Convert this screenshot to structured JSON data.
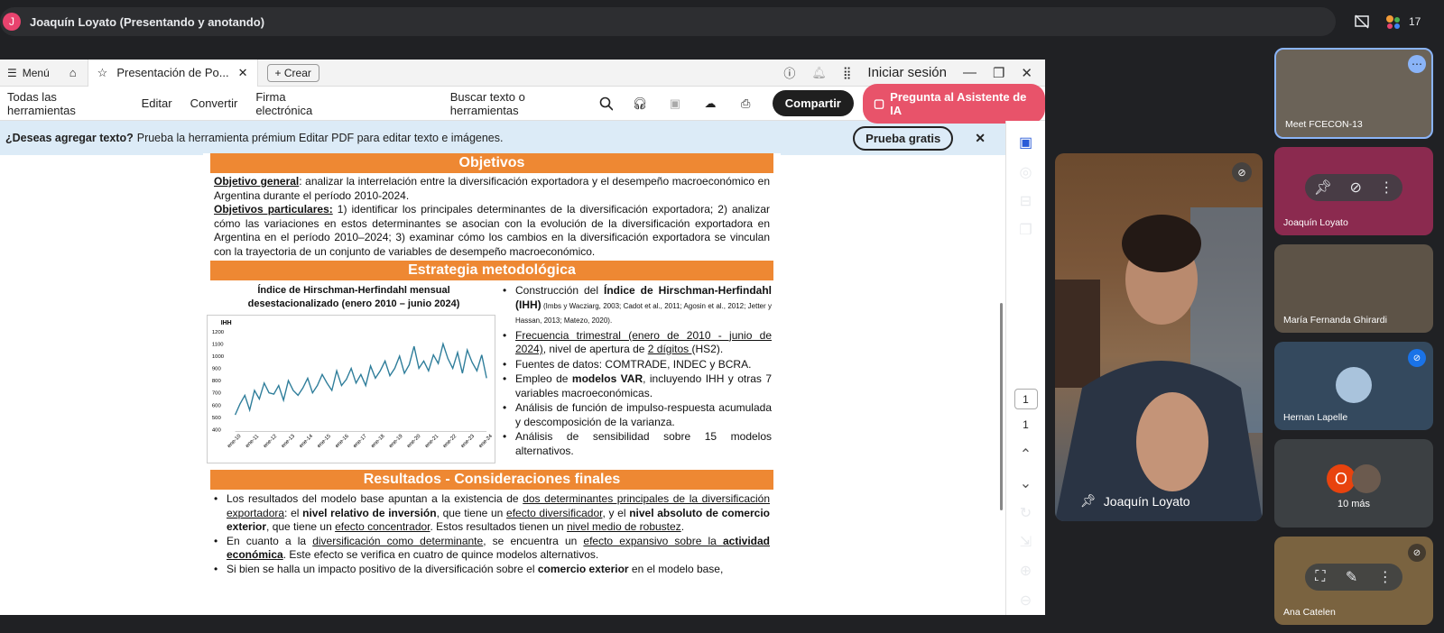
{
  "meet": {
    "presenter_initial": "J",
    "presenter_banner": "Joaquín Loyato (Presentando y anotando)",
    "participant_count": "17",
    "main_speaker": "Joaquín Loyato",
    "tiles": [
      {
        "name": "Meet FCECON-13"
      },
      {
        "name": "Joaquín Loyato"
      },
      {
        "name": "María Fernanda Ghirardi"
      },
      {
        "name": "Hernan Lapelle"
      },
      {
        "name": "10 más",
        "initial": "O"
      },
      {
        "name": "Ana Catelen"
      }
    ]
  },
  "reader": {
    "menu_label": "Menú",
    "tab_title": "Presentación de Po...",
    "create_label": "Crear",
    "login_label": "Iniciar sesión",
    "toolbar": [
      "Todas las herramientas",
      "Editar",
      "Convertir",
      "Firma electrónica"
    ],
    "search_label": "Buscar texto o herramientas",
    "share_label": "Compartir",
    "ai_label": "Pregunta al Asistente de IA",
    "banner_bold": "¿Deseas agregar texto?",
    "banner_text": "Prueba la herramienta prémium Editar PDF para editar texto e imágenes.",
    "try_label": "Prueba gratis",
    "page_box": "1",
    "page_total": "1"
  },
  "poster": {
    "obj_title": "Objetivos",
    "obj_general_label": "Objetivo general",
    "obj_general_text": ": analizar la interrelación entre la diversificación exportadora y el desempeño macroeconómico en Argentina durante el período 2010-2024.",
    "obj_part_label": "Objetivos particulares:",
    "obj_part_text": " 1) identificar los principales determinantes de la diversificación exportadora; 2) analizar cómo las variaciones en estos determinantes se asocian con la evolución de la diversificación exportadora en Argentina en el período 2010–2024; 3) examinar cómo los cambios en la diversificación exportadora se vinculan con la trayectoria de un conjunto de variables de desempeño macroeconómico.",
    "meth_title": "Estrategia metodológica",
    "chart_title_1": "Índice de Hirschman-Herfindahl mensual",
    "chart_title_2": "desestacionalizado (enero 2010 – junio 2024)",
    "meth_items": {
      "i1a": "Construcción del ",
      "i1b": "Índice de Hirschman-Herfindahl (IHH)",
      "i1c": " (Imbs y Wacziarg, 2003; Cadot et al., 2011; Agosin et al., 2012; Jetter y Hassan, 2013; Matezo, 2020).",
      "i2a": "Frecuencia trimestral (enero de 2010 - junio de 2024)",
      "i2b": ", nivel de apertura de ",
      "i2c": "2 dígitos ",
      "i2d": "(HS2).",
      "i3": "Fuentes de datos: COMTRADE, INDEC y BCRA.",
      "i4a": "Empleo de ",
      "i4b": "modelos VAR",
      "i4c": ", incluyendo IHH y otras 7 variables macroeconómicas.",
      "i5": "Análisis de función de impulso-respuesta acumulada y descomposición de la varianza.",
      "i6": "Análisis de sensibilidad sobre 15 modelos alternativos."
    },
    "res_title": "Resultados - Consideraciones finales",
    "res": {
      "r1a": "Los resultados del modelo base apuntan a la existencia de ",
      "r1b": "dos determinantes principales de la diversificación exportadora",
      "r1c": ": el ",
      "r1d": "nivel relativo de inversión",
      "r1e": ", que tiene un ",
      "r1f": "efecto diversificador",
      "r1g": ", y el ",
      "r1h": "nivel absoluto de comercio exterior",
      "r1i": ", que tiene un ",
      "r1j": "efecto concentrador",
      "r1k": ". Estos resultados tienen un ",
      "r1l": "nivel medio de robustez",
      "r1m": ".",
      "r2a": "En cuanto a la ",
      "r2b": "diversificación como determinante",
      "r2c": ", se encuentra un ",
      "r2d": "efecto expansivo sobre la ",
      "r2e": "actividad económica",
      "r2f": ". Este efecto se verifica en cuatro de quince modelos alternativos.",
      "r3a": "Si bien se halla un impacto positivo de la diversificación sobre el ",
      "r3b": "comercio exterior",
      "r3c": " en el modelo base,"
    }
  },
  "chart_data": {
    "type": "line",
    "ylabel": "IHH",
    "ylim": [
      400,
      1200
    ],
    "yticks": [
      "1200",
      "1100",
      "1000",
      "900",
      "800",
      "700",
      "600",
      "500",
      "400"
    ],
    "categories": [
      "ene-10",
      "ene-11",
      "ene-12",
      "ene-13",
      "ene-14",
      "ene-15",
      "ene-16",
      "ene-17",
      "ene-18",
      "ene-19",
      "ene-20",
      "ene-21",
      "ene-22",
      "ene-23",
      "ene-24"
    ],
    "values": [
      520,
      610,
      680,
      560,
      720,
      650,
      780,
      700,
      690,
      760,
      640,
      800,
      720,
      680,
      740,
      820,
      700,
      760,
      850,
      780,
      720,
      880,
      760,
      810,
      900,
      780,
      850,
      760,
      920,
      820,
      880,
      960,
      840,
      900,
      1000,
      860,
      930,
      1080,
      900,
      960,
      880,
      1010,
      940,
      1100,
      980,
      900,
      1030,
      860,
      1050,
      950,
      880,
      1010,
      820
    ]
  }
}
